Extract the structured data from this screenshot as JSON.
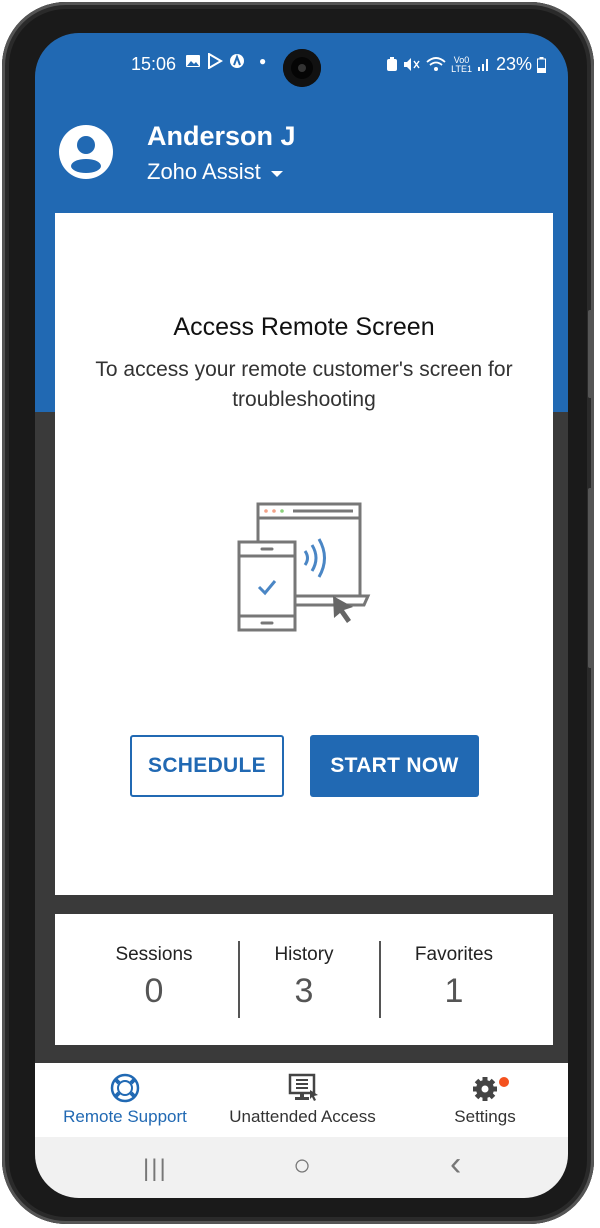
{
  "status_bar": {
    "time": "15:06",
    "left_icons": [
      "gallery-icon",
      "play-store-icon",
      "assist-icon",
      "dot"
    ],
    "right_icons": [
      "battery-saver-icon",
      "mute-icon",
      "wifi-icon",
      "volte-lte-icon",
      "signal-icon"
    ],
    "battery": "23%"
  },
  "header": {
    "user_name": "Anderson J",
    "org_name": "Zoho Assist",
    "avatar_icon": "account-circle-icon"
  },
  "card": {
    "title": "Access Remote Screen",
    "subtitle": "To access your remote customer's screen for troubleshooting",
    "illustration": "remote-screen-illustration",
    "schedule_label": "SCHEDULE",
    "start_label": "START NOW"
  },
  "stats": [
    {
      "label": "Sessions",
      "value": "0"
    },
    {
      "label": "History",
      "value": "3"
    },
    {
      "label": "Favorites",
      "value": "1"
    }
  ],
  "bottom_nav": [
    {
      "label": "Remote Support",
      "icon": "lifebuoy-icon",
      "active": true
    },
    {
      "label": "Unattended Access",
      "icon": "monitor-icon",
      "active": false
    },
    {
      "label": "Settings",
      "icon": "gear-icon",
      "active": false,
      "badge": true
    }
  ],
  "system_nav": {
    "recents": "|||",
    "home": "○",
    "back": "‹"
  },
  "colors": {
    "brand": "#2169b3",
    "badge": "#f4511e",
    "dark_bg": "#3a3a3a"
  }
}
